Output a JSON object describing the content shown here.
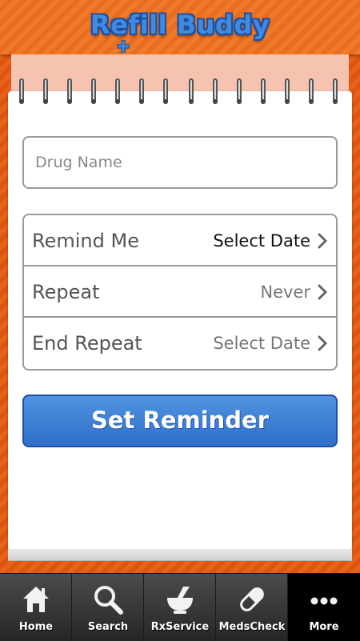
{
  "header": {
    "app_title": "Refill Buddy"
  },
  "form": {
    "drug_name_placeholder": "Drug Name",
    "drug_name_value": "",
    "rows": [
      {
        "label": "Remind Me",
        "value": "Select Date"
      },
      {
        "label": "Repeat",
        "value": "Never"
      },
      {
        "label": "End Repeat",
        "value": "Select Date"
      }
    ],
    "submit_label": "Set Reminder"
  },
  "tabs": [
    {
      "label": "Home",
      "icon": "home-icon"
    },
    {
      "label": "Search",
      "icon": "search-icon"
    },
    {
      "label": "RxService",
      "icon": "mortar-pestle-icon"
    },
    {
      "label": "MedsCheck",
      "icon": "pill-icon"
    },
    {
      "label": "More",
      "icon": "more-dots-icon",
      "active": true
    }
  ],
  "colors": {
    "brand_orange": "#e8621a",
    "button_blue": "#3a7fd5",
    "logo_blue": "#3f8be0"
  }
}
